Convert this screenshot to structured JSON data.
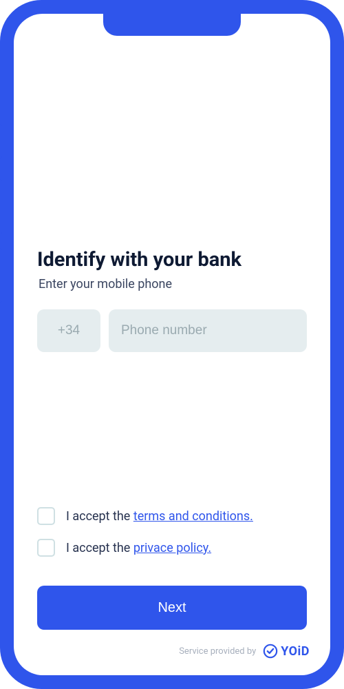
{
  "colors": {
    "accent": "#2f55eb",
    "field_bg": "#e5edef"
  },
  "header": {
    "title": "Identify with your bank",
    "subtitle": "Enter your mobile phone"
  },
  "phone": {
    "country_code_placeholder": "+34",
    "country_code_value": "",
    "number_placeholder": "Phone number",
    "number_value": ""
  },
  "checks": {
    "terms_prefix": "I accept the ",
    "terms_link": "terms and conditions.",
    "privacy_prefix": "I accept the ",
    "privacy_link": "privace policy."
  },
  "actions": {
    "next_label": "Next"
  },
  "footer": {
    "provided_by": "Service provided by",
    "brand": "YOiD"
  }
}
